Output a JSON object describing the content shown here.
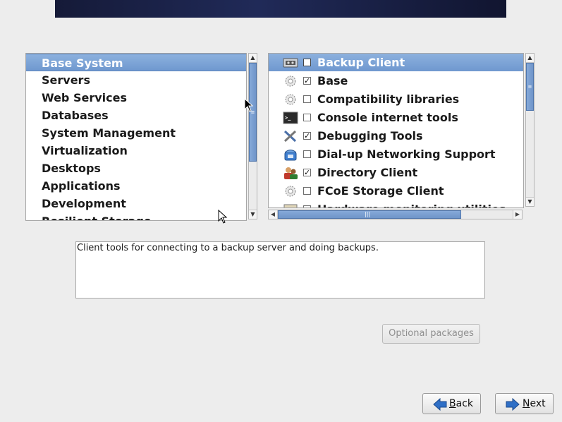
{
  "categories": [
    {
      "label": "Base System",
      "selected": true
    },
    {
      "label": "Servers"
    },
    {
      "label": "Web Services"
    },
    {
      "label": "Databases"
    },
    {
      "label": "System Management"
    },
    {
      "label": "Virtualization"
    },
    {
      "label": "Desktops"
    },
    {
      "label": "Applications"
    },
    {
      "label": "Development"
    },
    {
      "label": "Resilient Storage"
    }
  ],
  "packages": [
    {
      "label": "Backup Client",
      "checked": false,
      "icon": "backup-icon",
      "selected": true
    },
    {
      "label": "Base",
      "checked": true,
      "icon": "gear-icon"
    },
    {
      "label": "Compatibility libraries",
      "checked": false,
      "icon": "gear-icon"
    },
    {
      "label": "Console internet tools",
      "checked": false,
      "icon": "terminal-icon"
    },
    {
      "label": "Debugging Tools",
      "checked": true,
      "icon": "tools-icon"
    },
    {
      "label": "Dial-up Networking Support",
      "checked": false,
      "icon": "phone-icon"
    },
    {
      "label": "Directory Client",
      "checked": true,
      "icon": "users-icon"
    },
    {
      "label": "FCoE Storage Client",
      "checked": false,
      "icon": "gear-icon"
    },
    {
      "label": "Hardware monitoring utilities",
      "checked": false,
      "icon": "monitor-icon"
    }
  ],
  "description": "Client tools for connecting to a backup server and doing backups.",
  "buttons": {
    "optional": "Optional packages",
    "back": "Back",
    "back_accesskey": "B",
    "back_rest": "ack",
    "next": "Next",
    "next_accesskey": "N",
    "next_rest": "ext"
  },
  "colors": {
    "selection": "#7aa1d3",
    "arrow_blue": "#2f6fc6",
    "banner": "#1a2048"
  }
}
